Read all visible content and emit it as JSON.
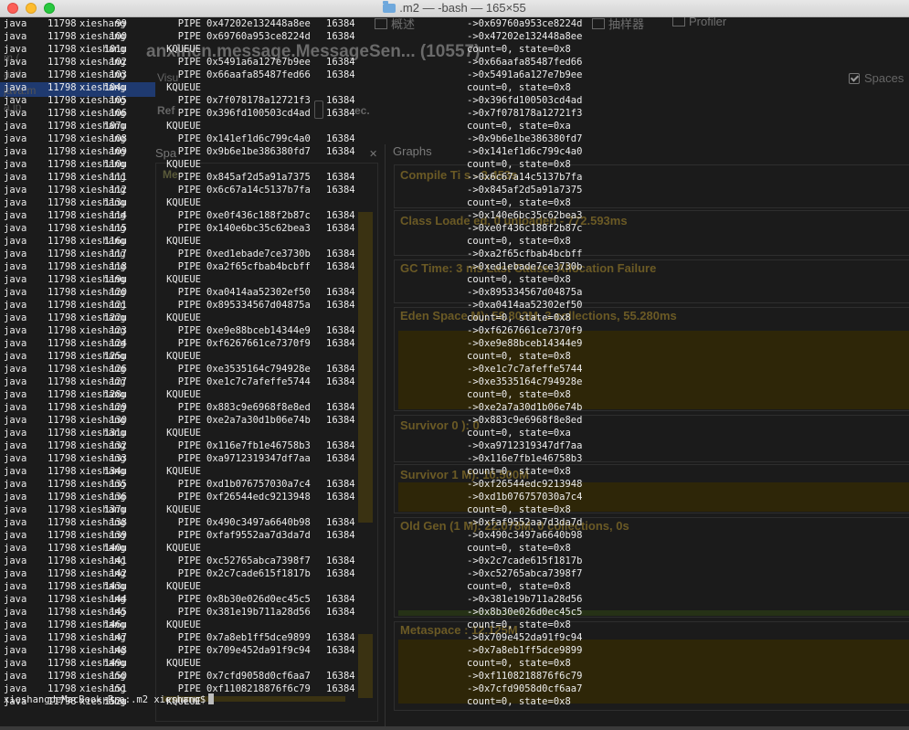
{
  "window": {
    "title": ".m2 — -bash — 165×55"
  },
  "background_app": {
    "toolbar": [
      "概述",
      "抽样器",
      "Profiler"
    ],
    "heading": "anxincn.message.MessageSen... (10557)",
    "left_items": [
      "m (",
      "a.id",
      "java.m",
      "a.jp"
    ],
    "visual_label": "Visu",
    "refresh_label": "Ref",
    "sec_label": "ec.",
    "spaces_label": "Spaces",
    "tab_left": "Spa",
    "tab_graphs": "Graphs",
    "left_pane_title": "Me",
    "panels": [
      {
        "title": "Compile Ti",
        "suffix": "s - 3.453s"
      },
      {
        "title": "Class Loade",
        "suffix": "ed, 0 unloaded - 772.593ms"
      },
      {
        "title": "GC Time: 3",
        "suffix": "ms Last Cause: Allocation Failure"
      },
      {
        "title": "Eden Space",
        "suffix": "M): 58.802M, 3 collections, 55.280ms"
      },
      {
        "title": "Survivor 0",
        "suffix": "): 0"
      },
      {
        "title": "Survivor 1",
        "suffix": "M): 10.500M"
      },
      {
        "title": "Old Gen (1",
        "suffix": "M): 22.078M, 0 collections, 0s"
      },
      {
        "title": "Metaspace",
        "suffix": ": 12.125M"
      }
    ]
  },
  "terminal": {
    "rows": [
      [
        "java",
        "11798",
        "xieshang",
        "99",
        "PIPE",
        "0x47202e132448a8ee",
        "16384",
        "->0x69760a953ce8224d"
      ],
      [
        "java",
        "11798",
        "xieshang",
        "100",
        "PIPE",
        "0x69760a953ce8224d",
        "16384",
        "->0x47202e132448a8ee"
      ],
      [
        "java",
        "11798",
        "xieshang",
        "101u",
        "KQUEUE",
        "",
        "",
        "count=0, state=0x8"
      ],
      [
        "java",
        "11798",
        "xieshang",
        "102",
        "PIPE",
        "0x5491a6a127e7b9ee",
        "16384",
        "->0x66aafa85487fed66"
      ],
      [
        "java",
        "11798",
        "xieshang",
        "103",
        "PIPE",
        "0x66aafa85487fed66",
        "16384",
        "->0x5491a6a127e7b9ee"
      ],
      [
        "java",
        "11798",
        "xieshang",
        "104u",
        "KQUEUE",
        "",
        "",
        "count=0, state=0x8"
      ],
      [
        "java",
        "11798",
        "xieshang",
        "105",
        "PIPE",
        "0x7f078178a12721f3",
        "16384",
        "->0x396fd100503cd4ad"
      ],
      [
        "java",
        "11798",
        "xieshang",
        "106",
        "PIPE",
        "0x396fd100503cd4ad",
        "16384",
        "->0x7f078178a12721f3"
      ],
      [
        "java",
        "11798",
        "xieshang",
        "107u",
        "KQUEUE",
        "",
        "",
        "count=0, state=0xa"
      ],
      [
        "java",
        "11798",
        "xieshang",
        "108",
        "PIPE",
        "0x141ef1d6c799c4a0",
        "16384",
        "->0x9b6e1be386380fd7"
      ],
      [
        "java",
        "11798",
        "xieshang",
        "109",
        "PIPE",
        "0x9b6e1be386380fd7",
        "16384",
        "->0x141ef1d6c799c4a0"
      ],
      [
        "java",
        "11798",
        "xieshang",
        "110u",
        "KQUEUE",
        "",
        "",
        "count=0, state=0x8"
      ],
      [
        "java",
        "11798",
        "xieshang",
        "111",
        "PIPE",
        "0x845af2d5a91a7375",
        "16384",
        "->0x6c67a14c5137b7fa"
      ],
      [
        "java",
        "11798",
        "xieshang",
        "112",
        "PIPE",
        "0x6c67a14c5137b7fa",
        "16384",
        "->0x845af2d5a91a7375"
      ],
      [
        "java",
        "11798",
        "xieshang",
        "113u",
        "KQUEUE",
        "",
        "",
        "count=0, state=0x8"
      ],
      [
        "java",
        "11798",
        "xieshang",
        "114",
        "PIPE",
        "0xe0f436c188f2b87c",
        "16384",
        "->0x140e6bc35c62bea3"
      ],
      [
        "java",
        "11798",
        "xieshang",
        "115",
        "PIPE",
        "0x140e6bc35c62bea3",
        "16384",
        "->0xe0f436c188f2b87c"
      ],
      [
        "java",
        "11798",
        "xieshang",
        "116u",
        "KQUEUE",
        "",
        "",
        "count=0, state=0x8"
      ],
      [
        "java",
        "11798",
        "xieshang",
        "117",
        "PIPE",
        "0xed1ebade7ce3730b",
        "16384",
        "->0xa2f65cfbab4bcbff"
      ],
      [
        "java",
        "11798",
        "xieshang",
        "118",
        "PIPE",
        "0xa2f65cfbab4bcbff",
        "16384",
        "->0xed1ebade7ce3730b"
      ],
      [
        "java",
        "11798",
        "xieshang",
        "119u",
        "KQUEUE",
        "",
        "",
        "count=0, state=0x8"
      ],
      [
        "java",
        "11798",
        "xieshang",
        "120",
        "PIPE",
        "0xa0414aa52302ef50",
        "16384",
        "->0x895334567d04875a"
      ],
      [
        "java",
        "11798",
        "xieshang",
        "121",
        "PIPE",
        "0x895334567d04875a",
        "16384",
        "->0xa0414aa52302ef50"
      ],
      [
        "java",
        "11798",
        "xieshang",
        "122u",
        "KQUEUE",
        "",
        "",
        "count=0, state=0x8"
      ],
      [
        "java",
        "11798",
        "xieshang",
        "123",
        "PIPE",
        "0xe9e88bceb14344e9",
        "16384",
        "->0xf6267661ce7370f9"
      ],
      [
        "java",
        "11798",
        "xieshang",
        "124",
        "PIPE",
        "0xf6267661ce7370f9",
        "16384",
        "->0xe9e88bceb14344e9"
      ],
      [
        "java",
        "11798",
        "xieshang",
        "125u",
        "KQUEUE",
        "",
        "",
        "count=0, state=0x8"
      ],
      [
        "java",
        "11798",
        "xieshang",
        "126",
        "PIPE",
        "0xe3535164c794928e",
        "16384",
        "->0xe1c7c7afeffe5744"
      ],
      [
        "java",
        "11798",
        "xieshang",
        "127",
        "PIPE",
        "0xe1c7c7afeffe5744",
        "16384",
        "->0xe3535164c794928e"
      ],
      [
        "java",
        "11798",
        "xieshang",
        "128u",
        "KQUEUE",
        "",
        "",
        "count=0, state=0x8"
      ],
      [
        "java",
        "11798",
        "xieshang",
        "129",
        "PIPE",
        "0x883c9e6968f8e8ed",
        "16384",
        "->0xe2a7a30d1b06e74b"
      ],
      [
        "java",
        "11798",
        "xieshang",
        "130",
        "PIPE",
        "0xe2a7a30d1b06e74b",
        "16384",
        "->0x883c9e6968f8e8ed"
      ],
      [
        "java",
        "11798",
        "xieshang",
        "131u",
        "KQUEUE",
        "",
        "",
        "count=0, state=0xa"
      ],
      [
        "java",
        "11798",
        "xieshang",
        "132",
        "PIPE",
        "0x116e7fb1e46758b3",
        "16384",
        "->0xa9712319347df7aa"
      ],
      [
        "java",
        "11798",
        "xieshang",
        "133",
        "PIPE",
        "0xa9712319347df7aa",
        "16384",
        "->0x116e7fb1e46758b3"
      ],
      [
        "java",
        "11798",
        "xieshang",
        "134u",
        "KQUEUE",
        "",
        "",
        "count=0, state=0x8"
      ],
      [
        "java",
        "11798",
        "xieshang",
        "135",
        "PIPE",
        "0xd1b076757030a7c4",
        "16384",
        "->0xf26544edc9213948"
      ],
      [
        "java",
        "11798",
        "xieshang",
        "136",
        "PIPE",
        "0xf26544edc9213948",
        "16384",
        "->0xd1b076757030a7c4"
      ],
      [
        "java",
        "11798",
        "xieshang",
        "137u",
        "KQUEUE",
        "",
        "",
        "count=0, state=0x8"
      ],
      [
        "java",
        "11798",
        "xieshang",
        "138",
        "PIPE",
        "0x490c3497a6640b98",
        "16384",
        "->0xfaf9552aa7d3da7d"
      ],
      [
        "java",
        "11798",
        "xieshang",
        "139",
        "PIPE",
        "0xfaf9552aa7d3da7d",
        "16384",
        "->0x490c3497a6640b98"
      ],
      [
        "java",
        "11798",
        "xieshang",
        "140u",
        "KQUEUE",
        "",
        "",
        "count=0, state=0x8"
      ],
      [
        "java",
        "11798",
        "xieshang",
        "141",
        "PIPE",
        "0xc52765abca7398f7",
        "16384",
        "->0x2c7cade615f1817b"
      ],
      [
        "java",
        "11798",
        "xieshang",
        "142",
        "PIPE",
        "0x2c7cade615f1817b",
        "16384",
        "->0xc52765abca7398f7"
      ],
      [
        "java",
        "11798",
        "xieshang",
        "143u",
        "KQUEUE",
        "",
        "",
        "count=0, state=0x8"
      ],
      [
        "java",
        "11798",
        "xieshang",
        "144",
        "PIPE",
        "0x8b30e026d0ec45c5",
        "16384",
        "->0x381e19b711a28d56"
      ],
      [
        "java",
        "11798",
        "xieshang",
        "145",
        "PIPE",
        "0x381e19b711a28d56",
        "16384",
        "->0x8b30e026d0ec45c5"
      ],
      [
        "java",
        "11798",
        "xieshang",
        "146u",
        "KQUEUE",
        "",
        "",
        "count=0, state=0x8"
      ],
      [
        "java",
        "11798",
        "xieshang",
        "147",
        "PIPE",
        "0x7a8eb1ff5dce9899",
        "16384",
        "->0x709e452da91f9c94"
      ],
      [
        "java",
        "11798",
        "xieshang",
        "148",
        "PIPE",
        "0x709e452da91f9c94",
        "16384",
        "->0x7a8eb1ff5dce9899"
      ],
      [
        "java",
        "11798",
        "xieshang",
        "149u",
        "KQUEUE",
        "",
        "",
        "count=0, state=0x8"
      ],
      [
        "java",
        "11798",
        "xieshang",
        "150",
        "PIPE",
        "0x7cfd9058d0cf6aa7",
        "16384",
        "->0xf1108218876f6c79"
      ],
      [
        "java",
        "11798",
        "xieshang",
        "151",
        "PIPE",
        "0xf1108218876f6c79",
        "16384",
        "->0x7cfd9058d0cf6aa7"
      ],
      [
        "java",
        "11798",
        "xieshang",
        "152u",
        "KQUEUE",
        "",
        "",
        "count=0, state=0x8"
      ]
    ],
    "prompt": "xieshangdeMacBook-Pro:.m2 xieshang$"
  }
}
